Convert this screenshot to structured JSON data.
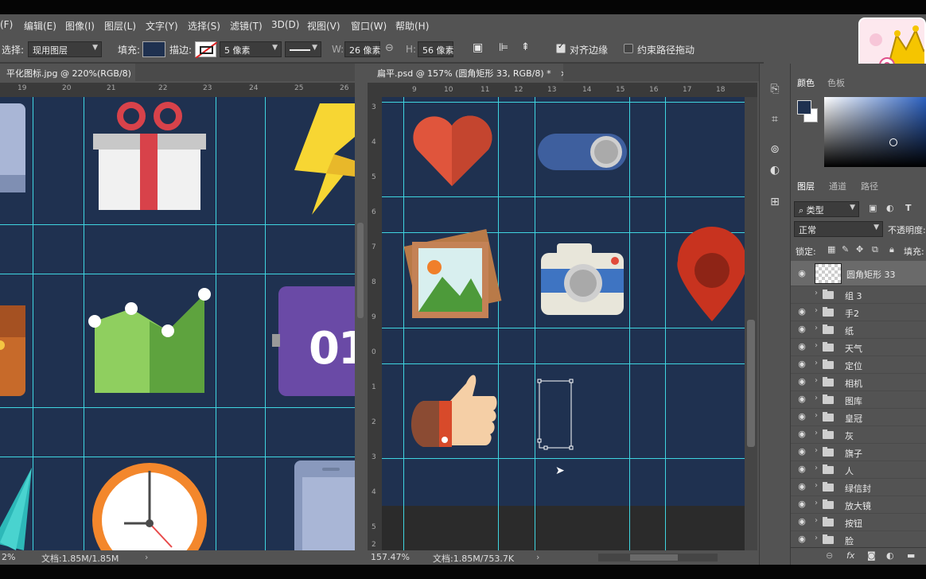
{
  "menu": [
    "(F)",
    "编辑(E)",
    "图像(I)",
    "图层(L)",
    "文字(Y)",
    "选择(S)",
    "滤镜(T)",
    "3D(D)",
    "视图(V)",
    "窗口(W)",
    "帮助(H)"
  ],
  "options": {
    "select_label": "选择:",
    "select_value": "现用图层",
    "fill_label": "填充:",
    "stroke_label": "描边:",
    "stroke_size": "5 像素",
    "w_label": "W:",
    "w_value": "26 像素",
    "h_label": "H:",
    "h_value": "56 像素",
    "align_edges": "对齐边缘",
    "constrain_path": "约束路径拖动"
  },
  "doc_left": {
    "tab": "平化图标.jpg @ 220%(RGB/8)",
    "close": "×",
    "ruler_numbers": [
      "19",
      "20",
      "21",
      "22",
      "23",
      "24",
      "25",
      "26"
    ],
    "zoom": "2%",
    "doc_info": "文档:1.85M/1.85M",
    "calendar_text": "01"
  },
  "doc_right": {
    "tab": "扁平.psd @ 157% (圆角矩形 33, RGB/8) *",
    "close": "×",
    "ruler_numbers": [
      "9",
      "10",
      "11",
      "12",
      "13",
      "14",
      "15",
      "16",
      "17",
      "18"
    ],
    "vruler_numbers": [
      "3",
      "4",
      "5",
      "6",
      "7",
      "8",
      "9",
      "0",
      "1",
      "2",
      "3",
      "4",
      "5",
      "2"
    ],
    "zoom": "157.47%",
    "doc_info": "文档:1.85M/753.7K"
  },
  "color_panel": {
    "tab1": "颜色",
    "tab2": "色板",
    "foreground": "#1f3150",
    "background": "#ffffff"
  },
  "layers_panel": {
    "tabs": [
      "图层",
      "通道",
      "路径"
    ],
    "filter": "类型",
    "blend": "正常",
    "opacity": "不透明度:",
    "lock": "锁定:",
    "fill": "填充:",
    "top_layer": "圆角矩形 33",
    "groups": [
      "组 3",
      "手2",
      "纸",
      "天气",
      "定位",
      "相机",
      "图库",
      "皇冠",
      "灰",
      "旗子",
      "人",
      "绿信封",
      "放大镜",
      "按钮",
      "脸"
    ]
  },
  "colors": {
    "canvas": "#1f3150",
    "guide": "#3fd5e0",
    "ui": "#535353"
  }
}
